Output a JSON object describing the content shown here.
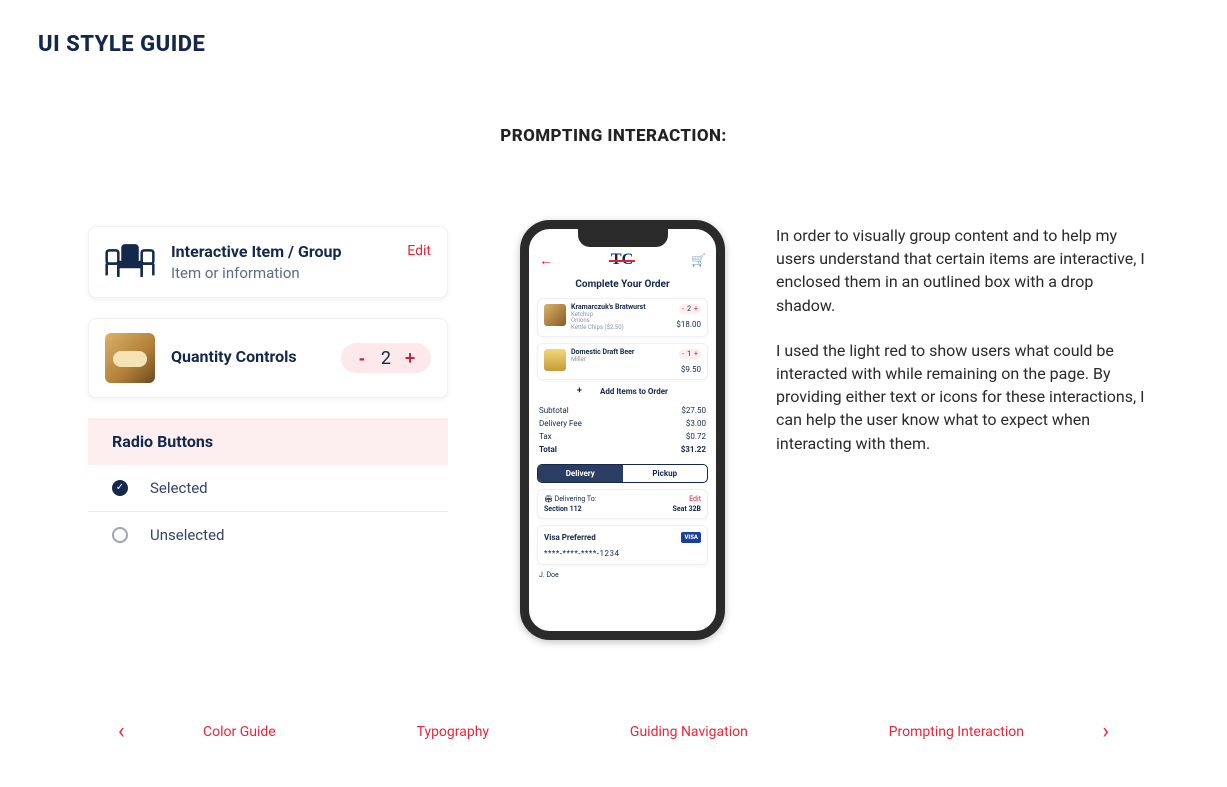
{
  "page_title": "UI STYLE GUIDE",
  "section_title": "PROMPTING INTERACTION:",
  "left": {
    "card1": {
      "title": "Interactive Item / Group",
      "sub": "Item or information",
      "edit": "Edit"
    },
    "card2": {
      "title": "Quantity Controls",
      "qty": "2"
    },
    "radio": {
      "header": "Radio Buttons",
      "selected": "Selected",
      "unselected": "Unselected"
    }
  },
  "phone": {
    "title": "Complete Your Order",
    "items": [
      {
        "name": "Kramarczuk's Bratwurst",
        "sub1": "Ketchup",
        "sub2": "Onions",
        "sub3": "Kettle Chips  ($2.50)",
        "qty": "2",
        "price": "$18.00"
      },
      {
        "name": "Domestic Draft Beer",
        "sub1": "Miller",
        "qty": "1",
        "price": "$9.50"
      }
    ],
    "add": "Add Items to Order",
    "summary": {
      "subtotal_l": "Subtotal",
      "subtotal_v": "$27.50",
      "fee_l": "Delivery Fee",
      "fee_v": "$3.00",
      "tax_l": "Tax",
      "tax_v": "$0.72",
      "total_l": "Total",
      "total_v": "$31.22"
    },
    "tabs": {
      "delivery": "Delivery",
      "pickup": "Pickup"
    },
    "deliver": {
      "label": "Delivering To:",
      "edit": "Edit",
      "section": "Section 112",
      "seat": "Seat 32B"
    },
    "pay": {
      "label": "Visa Preferred",
      "badge": "VISA",
      "num": "****-****-****-1234"
    },
    "cut": "J. Doe"
  },
  "right": {
    "p1": "In order to visually group content and to help my users understand that certain items are interactive, I enclosed them in an outlined box with a drop shadow.",
    "p2": "I used the light red to show users what could be interacted with while remaining on the page.  By providing either text or icons for these interactions, I can help the user know what to expect when interacting with them."
  },
  "footer": {
    "links": [
      "Color Guide",
      "Typography",
      "Guiding Navigation",
      "Prompting Interaction"
    ]
  }
}
